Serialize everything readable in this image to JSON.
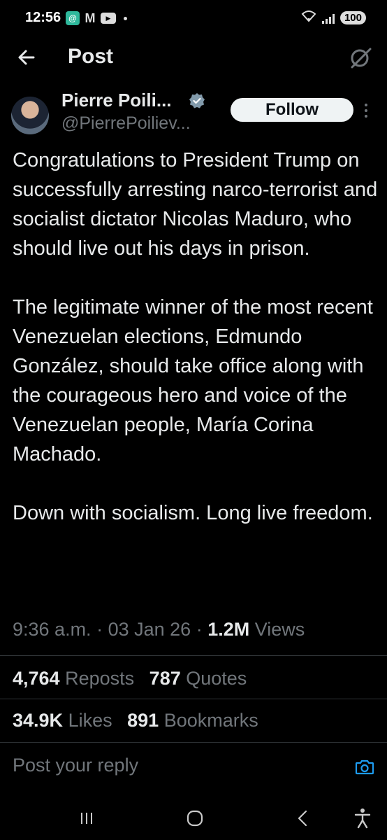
{
  "status_bar": {
    "time": "12:56",
    "battery": "100",
    "apps": [
      "threads-icon",
      "gmail-icon",
      "youtube-icon"
    ]
  },
  "header": {
    "title": "Post"
  },
  "author": {
    "name": "Pierre Poili...",
    "handle": "@PierrePoiliev...",
    "follow_label": "Follow",
    "verified_color": "#829aab"
  },
  "post": {
    "paragraphs": [
      "Congratulations to President Trump on successfully arresting narco-terrorist and socialist dictator Nicolas Maduro, who should live out his days in prison.",
      "The legitimate winner of the most recent Venezuelan elections, Edmundo González, should take office along with the courageous hero and voice of the Venezuelan people, María Corina Machado.",
      "Down with socialism. Long live freedom."
    ],
    "time": "9:36 a.m.",
    "date": "03 Jan 26",
    "views_count": "1.2M",
    "views_label": "Views"
  },
  "stats": {
    "reposts_count": "4,764",
    "reposts_label": "Reposts",
    "quotes_count": "787",
    "quotes_label": "Quotes",
    "likes_count": "34.9K",
    "likes_label": "Likes",
    "bookmarks_count": "891",
    "bookmarks_label": "Bookmarks"
  },
  "reply": {
    "placeholder": "Post your reply"
  },
  "colors": {
    "background": "#000000",
    "text": "#e7e9ea",
    "muted": "#71767b",
    "accent": "#1d9bf0"
  }
}
